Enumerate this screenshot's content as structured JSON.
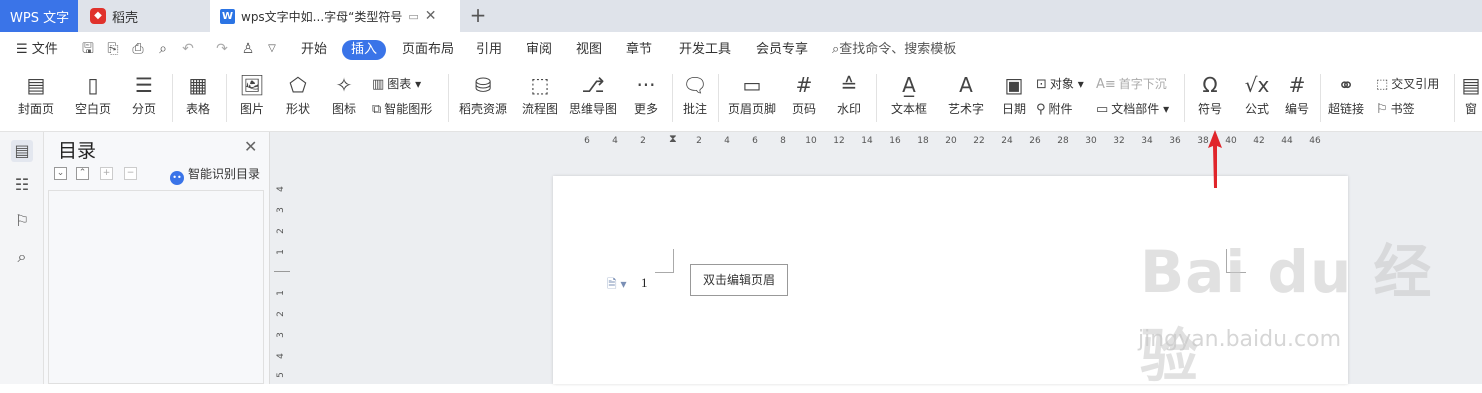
{
  "tabs": [
    {
      "label": "WPS 文字"
    },
    {
      "label": "稻壳",
      "icon": "daoke-logo-icon"
    },
    {
      "label": "wps文字中如...字母“类型符号",
      "icon": "wps-doc-icon"
    }
  ],
  "menu": {
    "file": "文件",
    "items": [
      "开始",
      "插入",
      "页面布局",
      "引用",
      "审阅",
      "视图",
      "章节",
      "开发工具",
      "会员专享"
    ],
    "active": "插入",
    "search_placeholder": "查找命令、搜索模板"
  },
  "toolbar": {
    "cover": "封面页",
    "blank": "空白页",
    "pagebreak": "分页",
    "table": "表格",
    "picture": "图片",
    "shape": "形状",
    "icon": "图标",
    "chart": "图表",
    "smartart": "智能图形",
    "daoke": "稻壳资源",
    "flowchart": "流程图",
    "mindmap": "思维导图",
    "more": "更多",
    "comment": "批注",
    "headerfooter": "页眉页脚",
    "pagenum": "页码",
    "watermark": "水印",
    "textbox": "文本框",
    "wordart": "艺术字",
    "date": "日期",
    "object": "对象",
    "attachment": "附件",
    "dropcap": "首字下沉",
    "docpart": "文档部件",
    "symbol": "符号",
    "formula": "公式",
    "numbering": "编号",
    "hyperlink": "超链接",
    "crossref": "交叉引用",
    "bookmark": "书签",
    "window": "窗"
  },
  "nav": {
    "title": "目录",
    "smart_label": "智能识别目录"
  },
  "ruler": {
    "h": [
      "6",
      "4",
      "2",
      "2",
      "4",
      "6",
      "8",
      "10",
      "12",
      "14",
      "16",
      "18",
      "20",
      "22",
      "24",
      "26",
      "28",
      "30",
      "32",
      "34",
      "36",
      "38",
      "40",
      "42",
      "44",
      "46"
    ],
    "v": [
      "4",
      "3",
      "2",
      "1",
      "1",
      "2",
      "3",
      "4",
      "5"
    ]
  },
  "page": {
    "header_button": "双击编辑页眉",
    "page_number": "1"
  },
  "watermark": {
    "main": "Bai du 经验",
    "sub": "jingyan.baidu.com"
  },
  "colors": {
    "accent": "#3a74e8",
    "arrow": "#e0252b"
  }
}
